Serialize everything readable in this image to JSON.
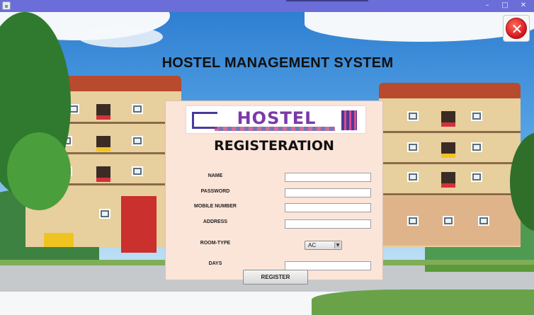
{
  "window": {
    "title": "",
    "controls": {
      "minimize": "–",
      "maximize": "□",
      "close": "✕"
    }
  },
  "header": {
    "title": "HOSTEL MANAGEMENT SYSTEM",
    "close_icon": "close-icon"
  },
  "logo": {
    "text": "HOSTEL"
  },
  "form": {
    "title": "REGISTERATION",
    "fields": {
      "name": {
        "label": "NAME",
        "value": ""
      },
      "password": {
        "label": "PASSWORD",
        "value": ""
      },
      "mobile": {
        "label": "MOBILE NUMBER",
        "value": ""
      },
      "address": {
        "label": "ADDRESS",
        "value": ""
      },
      "room_type": {
        "label": "ROOM-TYPE",
        "selected": "AC"
      },
      "days": {
        "label": "DAYS",
        "value": ""
      }
    },
    "register_label": "REGISTER"
  },
  "colors": {
    "titlebar": "#6b6dd8",
    "panel": "#fbe4d8",
    "close": "#d4131b"
  }
}
